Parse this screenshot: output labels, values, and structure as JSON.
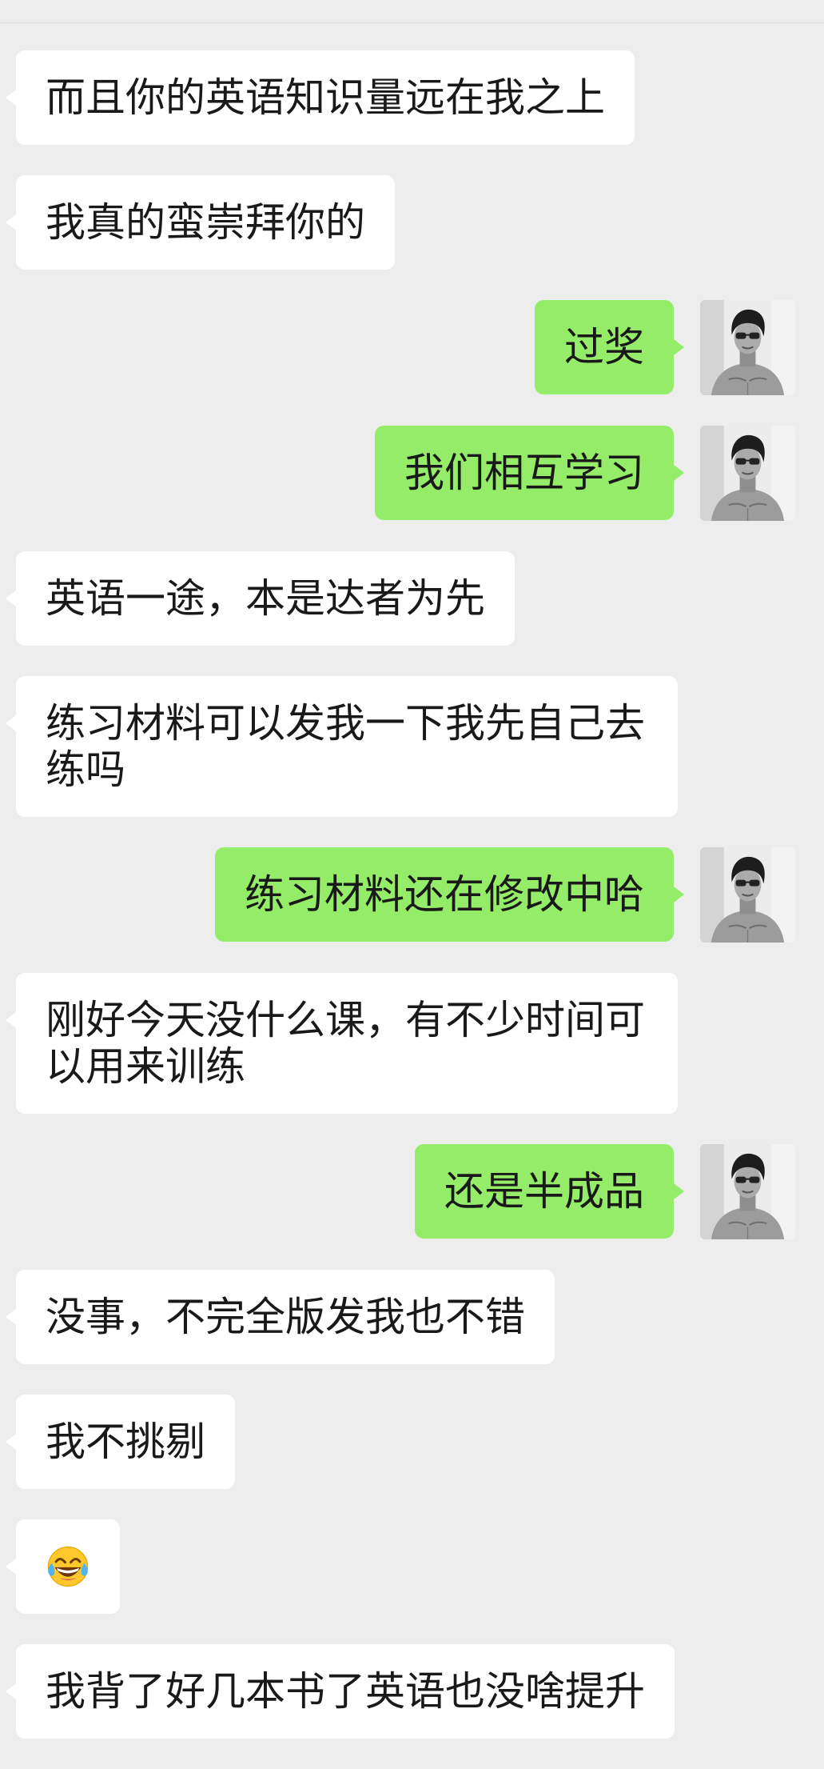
{
  "chat": {
    "messages": [
      {
        "outgoing": false,
        "text": "而且你的英语知识量远在我之上"
      },
      {
        "outgoing": false,
        "text": "我真的蛮崇拜你的"
      },
      {
        "outgoing": true,
        "text": "过奖"
      },
      {
        "outgoing": true,
        "text": "我们相互学习"
      },
      {
        "outgoing": false,
        "text": "英语一途，本是达者为先"
      },
      {
        "outgoing": false,
        "text": "练习材料可以发我一下我先自己去练吗"
      },
      {
        "outgoing": true,
        "text": "练习材料还在修改中哈"
      },
      {
        "outgoing": false,
        "text": "刚好今天没什么课，有不少时间可以用来训练"
      },
      {
        "outgoing": true,
        "text": "还是半成品"
      },
      {
        "outgoing": false,
        "text": "没事，不完全版发我也不错"
      },
      {
        "outgoing": false,
        "text": "我不挑剔"
      },
      {
        "outgoing": false,
        "icon": "face-with-tears-of-joy-icon"
      },
      {
        "outgoing": false,
        "text": "我背了好几本书了英语也没啥提升"
      }
    ],
    "my_avatar_icon": "avatar-photo-icon"
  },
  "colors": {
    "background": "#ededed",
    "incoming_bubble": "#ffffff",
    "outgoing_bubble": "#95ec69",
    "text": "#191919"
  }
}
